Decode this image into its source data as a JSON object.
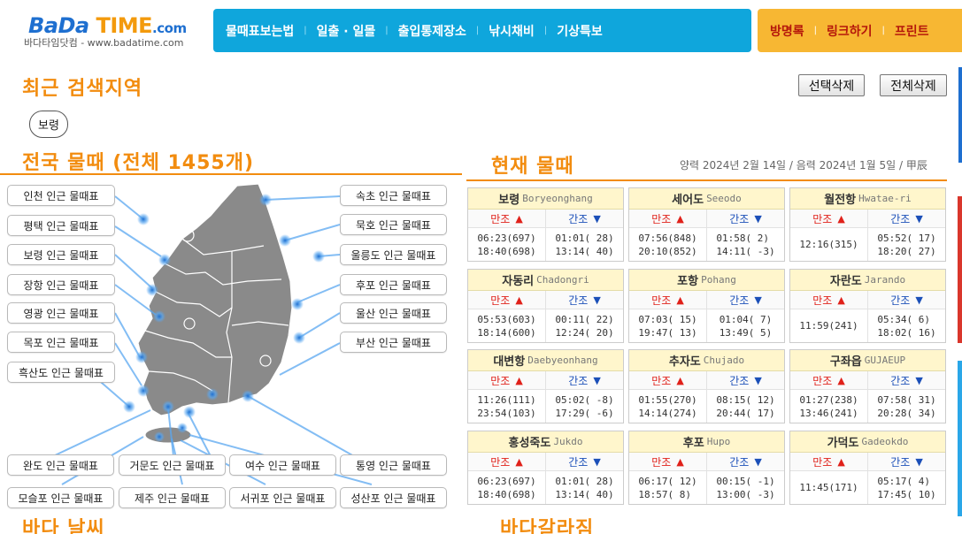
{
  "header": {
    "logo_part1": "BaDa",
    "logo_part2": "TIME",
    "logo_part3": ".com",
    "logo_sub": "바다타임닷컴 - www.badatime.com",
    "main_nav": [
      "물때표보는법",
      "일출 · 일몰",
      "출입통제장소",
      "낚시채비",
      "기상특보"
    ],
    "sub_nav": [
      "방명록",
      "링크하기",
      "프린트"
    ],
    "nav_bg": "#0fa6dc",
    "subnav_bg": "#f7b733"
  },
  "recent": {
    "title": "최근 검색지역",
    "chip": "보령",
    "delete_selected": "선택삭제",
    "delete_all": "전체삭제"
  },
  "national": {
    "title": "전국 물때 (전체 1455개)",
    "left_regions": [
      "인천 인근 물때표",
      "평택 인근 물때표",
      "보령 인근 물때표",
      "장항 인근 물때표",
      "영광 인근 물때표",
      "목포 인근 물때표",
      "흑산도 인근 물때표"
    ],
    "right_regions": [
      "속초 인근 물때표",
      "묵호 인근 물때표",
      "울릉도 인근 물때표",
      "후포 인근 물때표",
      "울산 인근 물때표",
      "부산 인근 물때표"
    ],
    "bottom_row1": [
      "완도 인근 물때표",
      "거문도 인근 물때표",
      "여수 인근 물때표",
      "통영 인근 물때표"
    ],
    "bottom_row2": [
      "모슬포 인근 물때표",
      "제주 인근 물때표",
      "서귀포 인근 물때표",
      "성산포 인근 물때표"
    ]
  },
  "current": {
    "title": "현재 물때",
    "date_line": "양력 2024년 2월 14일 / 음력 2024년 1월 5일 / 甲辰",
    "high_label": "만조",
    "low_label": "간조",
    "up_arrow": "▲",
    "down_arrow": "▼",
    "high_color": "#e0211a",
    "low_color": "#1b4fb8",
    "stations": [
      {
        "kname": "보령",
        "ename": "Boryeonghang",
        "high": "06:23(697)\n18:40(698)",
        "low": "01:01( 28)\n13:14( 40)"
      },
      {
        "kname": "세어도",
        "ename": "Seeodo",
        "high": "07:56(848)\n20:10(852)",
        "low": "01:58( 2)\n14:11( -3)"
      },
      {
        "kname": "월전항",
        "ename": "Hwatae-ri",
        "high": "12:16(315)",
        "low": "05:52( 17)\n18:20( 27)"
      },
      {
        "kname": "자동리",
        "ename": "Chadongri",
        "high": "05:53(603)\n18:14(600)",
        "low": "00:11( 22)\n12:24( 20)"
      },
      {
        "kname": "포항",
        "ename": "Pohang",
        "high": "07:03( 15)\n19:47( 13)",
        "low": "01:04( 7)\n13:49( 5)"
      },
      {
        "kname": "자란도",
        "ename": "Jarando",
        "high": "11:59(241)",
        "low": "05:34( 6)\n18:02( 16)"
      },
      {
        "kname": "대변항",
        "ename": "Daebyeonhang",
        "high": "11:26(111)\n23:54(103)",
        "low": "05:02( -8)\n17:29( -6)"
      },
      {
        "kname": "추자도",
        "ename": "Chujado",
        "high": "01:55(270)\n14:14(274)",
        "low": "08:15( 12)\n20:44( 17)"
      },
      {
        "kname": "구좌읍",
        "ename": "GUJAEUP",
        "high": "01:27(238)\n13:46(241)",
        "low": "07:58( 31)\n20:28( 34)"
      },
      {
        "kname": "홍성죽도",
        "ename": "Jukdo",
        "high": "06:23(697)\n18:40(698)",
        "low": "01:01( 28)\n13:14( 40)"
      },
      {
        "kname": "후포",
        "ename": "Hupo",
        "high": "06:17( 12)\n18:57( 8)",
        "low": "00:15( -1)\n13:00( -3)"
      },
      {
        "kname": "가덕도",
        "ename": "Gadeokdo",
        "high": "11:45(171)",
        "low": "05:17( 4)\n17:45( 10)"
      }
    ]
  },
  "footer_titles": {
    "weather": "바다 날씨",
    "tidal_flat": "바다갈라짐"
  }
}
